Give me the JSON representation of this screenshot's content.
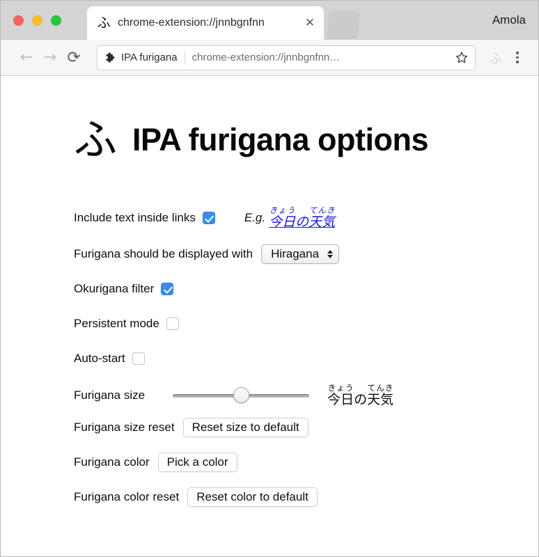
{
  "window": {
    "traffic_lights": [
      "close",
      "minimize",
      "zoom"
    ],
    "profile_name": "Amola"
  },
  "tab": {
    "favicon_glyph": "ふ",
    "title": "chrome-extension://jnnbgnfnn",
    "close_glyph": "✕"
  },
  "toolbar": {
    "back_glyph": "←",
    "forward_glyph": "→",
    "reload_glyph": "⟳",
    "extension_chip_label": "IPA furigana",
    "url": "chrome-extension://jnnbgnfnn…",
    "extension_action_glyph": "ふ"
  },
  "page": {
    "brand_glyph": "ふ",
    "title": "IPA furigana options",
    "options": [
      {
        "id": "include-links",
        "label": "Include text inside links",
        "control": "checkbox",
        "checked": true
      },
      {
        "id": "display-with",
        "label": "Furigana should be displayed with",
        "control": "select",
        "value": "Hiragana"
      },
      {
        "id": "okurigana-filter",
        "label": "Okurigana filter",
        "control": "checkbox",
        "checked": true
      },
      {
        "id": "persistent-mode",
        "label": "Persistent mode",
        "control": "checkbox",
        "checked": false
      },
      {
        "id": "auto-start",
        "label": "Auto-start",
        "control": "checkbox",
        "checked": false
      },
      {
        "id": "furigana-size",
        "label": "Furigana size",
        "control": "slider",
        "value_percent": 50
      },
      {
        "id": "furigana-size-reset",
        "label": "Furigana size reset",
        "control": "button",
        "button_label": "Reset size to default"
      },
      {
        "id": "furigana-color",
        "label": "Furigana color",
        "control": "button",
        "button_label": "Pick a color"
      },
      {
        "id": "furigana-color-reset",
        "label": "Furigana color reset",
        "control": "button",
        "button_label": "Reset color to default"
      }
    ],
    "example": {
      "eg_prefix": "E.g.",
      "link_color": "#1818d6",
      "ruby": [
        {
          "base": "今日",
          "reading": "きょう"
        },
        {
          "base": "の",
          "reading": ""
        },
        {
          "base": "天気",
          "reading": "てんき"
        }
      ]
    }
  }
}
